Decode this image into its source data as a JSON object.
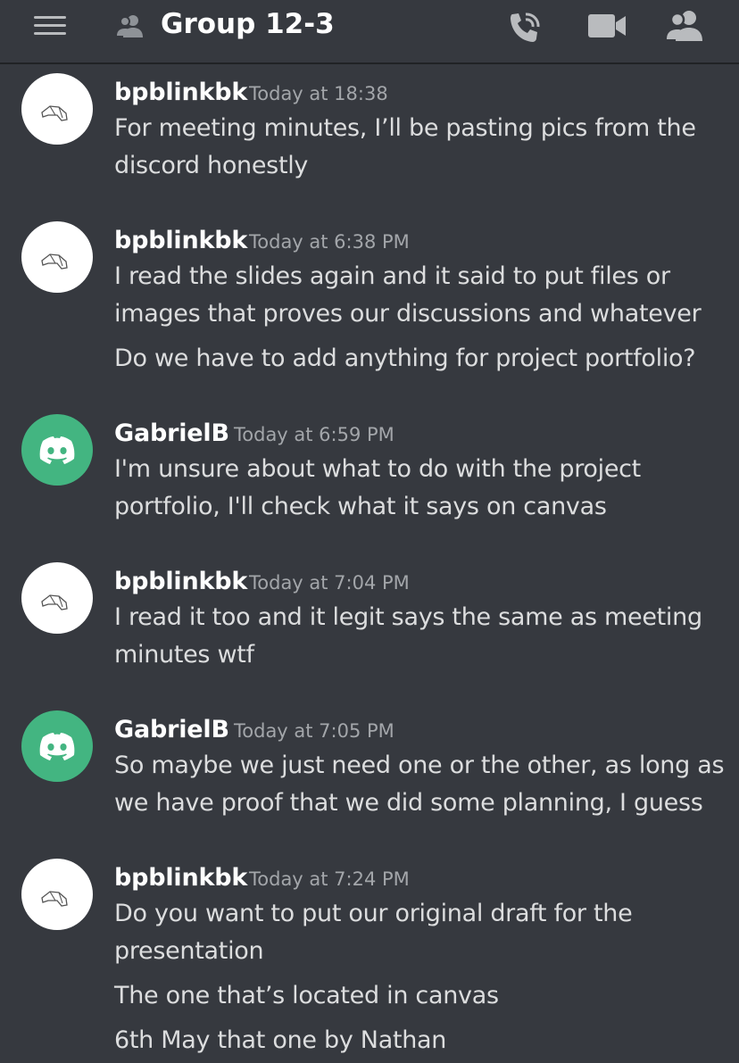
{
  "header": {
    "title": "Group 12-3",
    "icons": [
      "menu-icon",
      "group-icon",
      "voice-call-icon",
      "video-call-icon",
      "members-icon"
    ]
  },
  "colors": {
    "background": "#36393f",
    "header_border": "#202225",
    "username": "#ffffff",
    "timestamp": "#a3a6aa",
    "message_text": "#dcddde",
    "discord_avatar": "#43b581"
  },
  "messages": [
    {
      "author": "bpblinkbk",
      "time": "Today at 18:38",
      "avatar": "hand-drawn-avatar",
      "lines": [
        "For meeting minutes, I’ll be pasting pics from the",
        "discord honestly"
      ]
    },
    {
      "author": "bpblinkbk",
      "time": "Today at 6:38 PM",
      "avatar": "hand-drawn-avatar",
      "lines": [
        "I read the slides again and it said to put files or",
        "images that proves our discussions and whatever",
        "Do we have to add anything for project portfolio?"
      ]
    },
    {
      "author": "GabrielB",
      "time": "Today at 6:59 PM",
      "avatar": "discord-logo-avatar",
      "lines": [
        "I'm unsure about what to do with the project",
        "portfolio, I'll check what it says on canvas"
      ]
    },
    {
      "author": "bpblinkbk",
      "time": "Today at 7:04 PM",
      "avatar": "hand-drawn-avatar",
      "lines": [
        "I read it too and it legit says the same as meeting",
        "minutes wtf"
      ]
    },
    {
      "author": "GabrielB",
      "time": "Today at 7:05 PM",
      "avatar": "discord-logo-avatar",
      "lines": [
        "So maybe we just need one or the other, as long as",
        "we have proof that we did some planning, I guess"
      ]
    },
    {
      "author": "bpblinkbk",
      "time": "Today at 7:24 PM",
      "avatar": "hand-drawn-avatar",
      "lines": [
        "Do you want to put our original draft for the",
        "presentation",
        "The one that’s located in canvas",
        "6th May that one by Nathan"
      ]
    }
  ]
}
